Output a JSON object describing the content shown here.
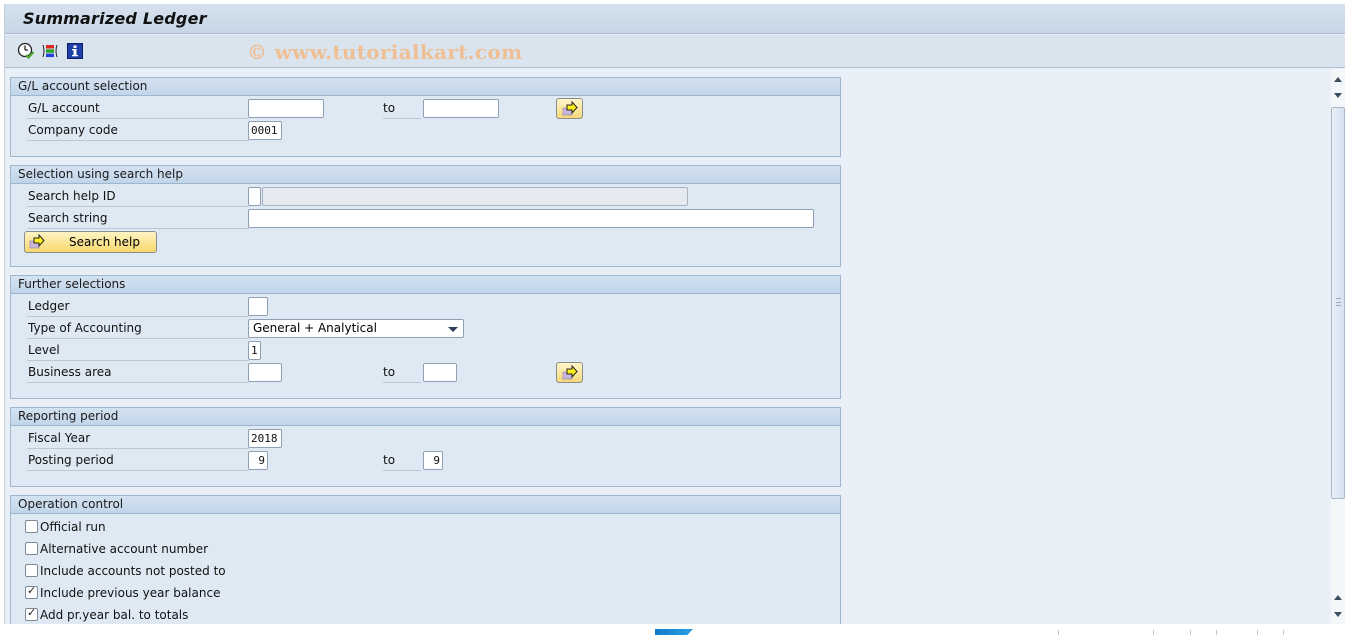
{
  "window": {
    "title": "Summarized Ledger",
    "watermark": "© www.tutorialkart.com"
  },
  "toolbar": {
    "icons": [
      {
        "name": "execute-background-icon",
        "tooltip": "Execute in Background"
      },
      {
        "name": "selection-options-icon",
        "tooltip": "Dynamic Selections"
      },
      {
        "name": "info-icon",
        "tooltip": "Program Documentation"
      }
    ]
  },
  "groups": {
    "gl_account_selection": {
      "title": "G/L account selection",
      "gl_account": {
        "label": "G/L account",
        "from": "",
        "to_label": "to",
        "to": ""
      },
      "company_code": {
        "label": "Company code",
        "value": "0001"
      }
    },
    "search_help": {
      "title": "Selection using search help",
      "search_help_id": {
        "label": "Search help ID",
        "value": "",
        "description": ""
      },
      "search_string": {
        "label": "Search string",
        "value": ""
      },
      "button_label": "Search help"
    },
    "further_selections": {
      "title": "Further selections",
      "ledger": {
        "label": "Ledger",
        "value": ""
      },
      "type_of_accounting": {
        "label": "Type of Accounting",
        "selected": "General + Analytical"
      },
      "level": {
        "label": "Level",
        "value": "1"
      },
      "business_area": {
        "label": "Business area",
        "from": "",
        "to_label": "to",
        "to": ""
      }
    },
    "reporting_period": {
      "title": "Reporting period",
      "fiscal_year": {
        "label": "Fiscal Year",
        "value": "2018"
      },
      "posting_period": {
        "label": "Posting period",
        "from": "9",
        "to_label": "to",
        "to": "9"
      }
    },
    "operation_control": {
      "title": "Operation control",
      "options": [
        {
          "label": "Official run",
          "checked": false
        },
        {
          "label": "Alternative account number",
          "checked": false
        },
        {
          "label": "Include accounts not posted to",
          "checked": false
        },
        {
          "label": "Include previous year balance",
          "checked": true
        },
        {
          "label": "Add pr.year bal. to totals",
          "checked": true
        }
      ]
    }
  },
  "colors": {
    "background": "#e8eff7",
    "group_header": "#c7d9ec",
    "button_yellow": "#f7d86d",
    "watermark": "#efbf93"
  }
}
